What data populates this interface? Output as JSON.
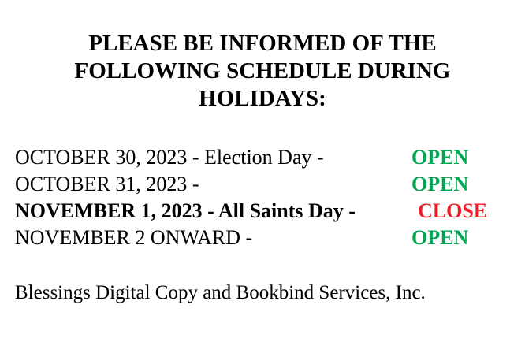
{
  "heading": {
    "lines": [
      "PLEASE BE INFORMED OF THE",
      "FOLLOWING SCHEDULE DURING",
      "HOLIDAYS:"
    ]
  },
  "schedule": {
    "rows": [
      {
        "date": "OCTOBER 30, 2023  -  Election Day   -",
        "status": "OPEN",
        "status_color": "#00a651",
        "bold": false
      },
      {
        "date": "OCTOBER 31, 2023  -",
        "status": "OPEN",
        "status_color": "#00a651",
        "bold": false
      },
      {
        "date": "NOVEMBER 1, 2023 -  All Saints Day -",
        "status": "CLOSE",
        "status_color": "#ee1c25",
        "bold": true
      },
      {
        "date": "NOVEMBER 2 ONWARD -",
        "status": "OPEN",
        "status_color": "#00a651",
        "bold": false
      }
    ]
  },
  "footer": {
    "company": "Blessings Digital Copy and Bookbind Services, Inc."
  }
}
